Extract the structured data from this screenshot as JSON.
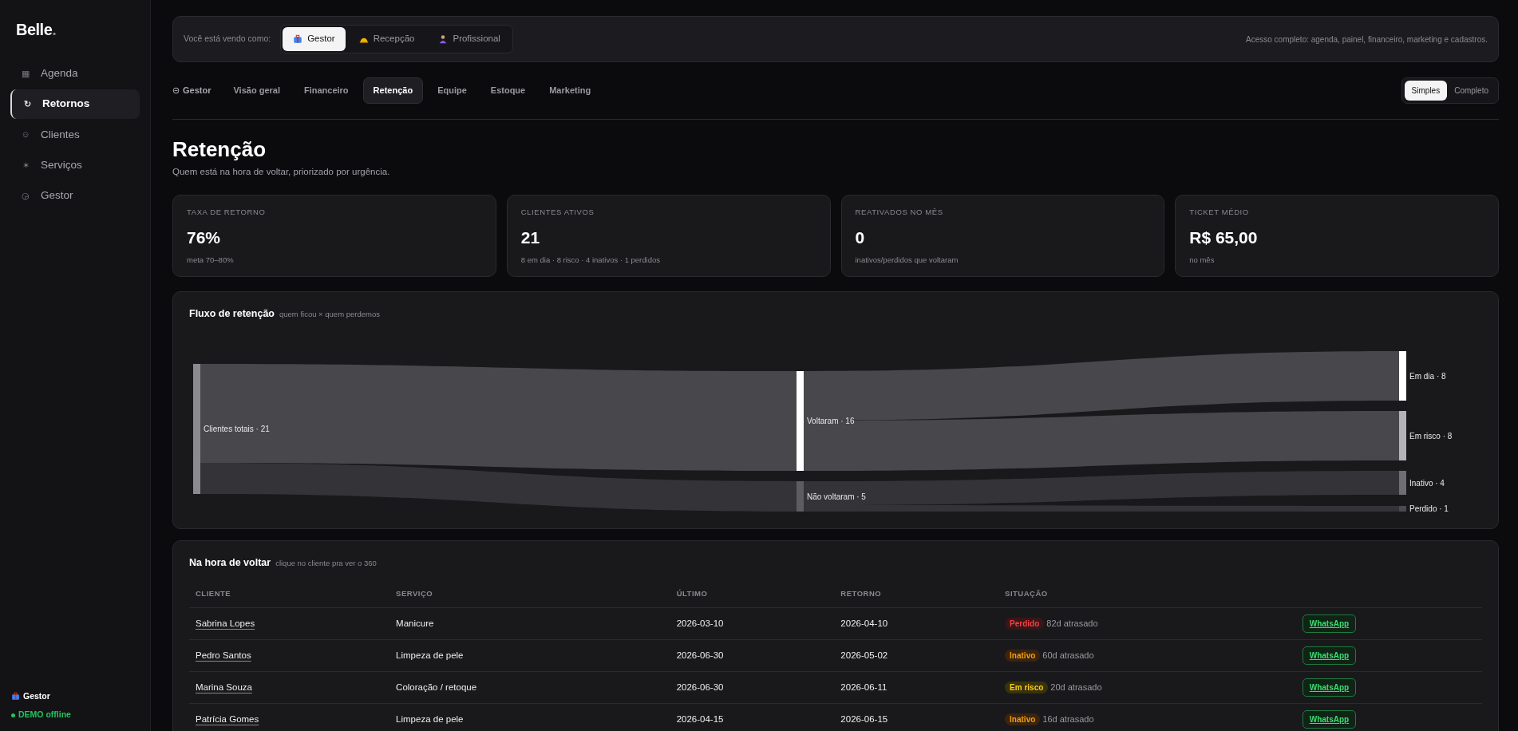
{
  "sidebar": {
    "logo": "Belle",
    "logo_dot": ".",
    "items": [
      {
        "icon": "▦",
        "label": "Agenda",
        "selected": false
      },
      {
        "icon": "↻",
        "label": "Retornos",
        "selected": true
      },
      {
        "icon": "☺",
        "label": "Clientes",
        "selected": false
      },
      {
        "icon": "✶",
        "label": "Serviços",
        "selected": false
      },
      {
        "icon": "◶",
        "label": "Gestor",
        "selected": false
      }
    ],
    "footer": {
      "role": "Gestor",
      "status": {
        "label": "DEMO offline",
        "color": "#22c55e"
      }
    }
  },
  "role_bar": {
    "label": "Você está vendo como:",
    "roles": [
      {
        "label": "Gestor",
        "selected": true
      },
      {
        "label": "Recepção",
        "selected": false
      },
      {
        "label": "Profissional",
        "selected": false
      }
    ],
    "description": "Acesso completo: agenda, painel, financeiro, marketing e cadastros."
  },
  "section": "Gestor",
  "tabs": [
    {
      "label": "Visão geral",
      "selected": false
    },
    {
      "label": "Financeiro",
      "selected": false
    },
    {
      "label": "Retenção",
      "selected": true
    },
    {
      "label": "Equipe",
      "selected": false
    },
    {
      "label": "Estoque",
      "selected": false
    },
    {
      "label": "Marketing",
      "selected": false
    }
  ],
  "view_modes": [
    {
      "label": "Simples",
      "selected": true
    },
    {
      "label": "Completo",
      "selected": false
    }
  ],
  "page": {
    "title": "Retenção",
    "subtitle": "Quem está na hora de voltar, priorizado por urgência."
  },
  "stats": [
    {
      "label": "TAXA DE RETORNO",
      "value": "76%",
      "note": "meta 70–80%"
    },
    {
      "label": "CLIENTES ATIVOS",
      "value": "21",
      "note": "8 em dia · 8 risco · 4 inativos · 1 perdidos"
    },
    {
      "label": "REATIVADOS NO MÊS",
      "value": "0",
      "note": "inativos/perdidos que voltaram"
    },
    {
      "label": "TICKET MÉDIO",
      "value": "R$ 65,00",
      "note": "no mês"
    }
  ],
  "flow": {
    "title": "Fluxo de retenção",
    "subtitle": "quem ficou × quem perdemos",
    "nodes": [
      {
        "label": "Clientes totais · 21",
        "color": "#8a8a90"
      },
      {
        "label": "Voltaram · 16",
        "color": "#ffffff"
      },
      {
        "label": "Não voltaram · 5",
        "color": "#5c5c62"
      },
      {
        "label": "Em dia · 8",
        "color": "#ffffff"
      },
      {
        "label": "Em risco · 8",
        "color": "#b4b4b8"
      },
      {
        "label": "Inativo · 4",
        "color": "#6e6e74"
      },
      {
        "label": "Perdido · 1",
        "color": "#4a4a50"
      }
    ]
  },
  "table": {
    "title": "Na hora de voltar",
    "subtitle": "clique no cliente pra ver o 360",
    "columns": [
      "CLIENTE",
      "SERVIÇO",
      "ÚLTIMO",
      "RETORNO",
      "SITUAÇÃO"
    ],
    "rows": [
      {
        "client": "Sabrina Lopes",
        "service": "Manicure",
        "last": "2026-03-10",
        "return": "2026-04-10",
        "status": {
          "kind": "lost",
          "label": "Perdido"
        },
        "delay": "82d atrasado",
        "action": "WhatsApp"
      },
      {
        "client": "Pedro Santos",
        "service": "Limpeza de pele",
        "last": "2026-06-30",
        "return": "2026-05-02",
        "status": {
          "kind": "inactive",
          "label": "Inativo"
        },
        "delay": "60d atrasado",
        "action": "WhatsApp"
      },
      {
        "client": "Marina Souza",
        "service": "Coloração / retoque",
        "last": "2026-06-30",
        "return": "2026-06-11",
        "status": {
          "kind": "risk",
          "label": "Em risco"
        },
        "delay": "20d atrasado",
        "action": "WhatsApp"
      },
      {
        "client": "Patrícia Gomes",
        "service": "Limpeza de pele",
        "last": "2026-04-15",
        "return": "2026-06-15",
        "status": {
          "kind": "inactive",
          "label": "Inativo"
        },
        "delay": "16d atrasado",
        "action": "WhatsApp"
      }
    ]
  }
}
